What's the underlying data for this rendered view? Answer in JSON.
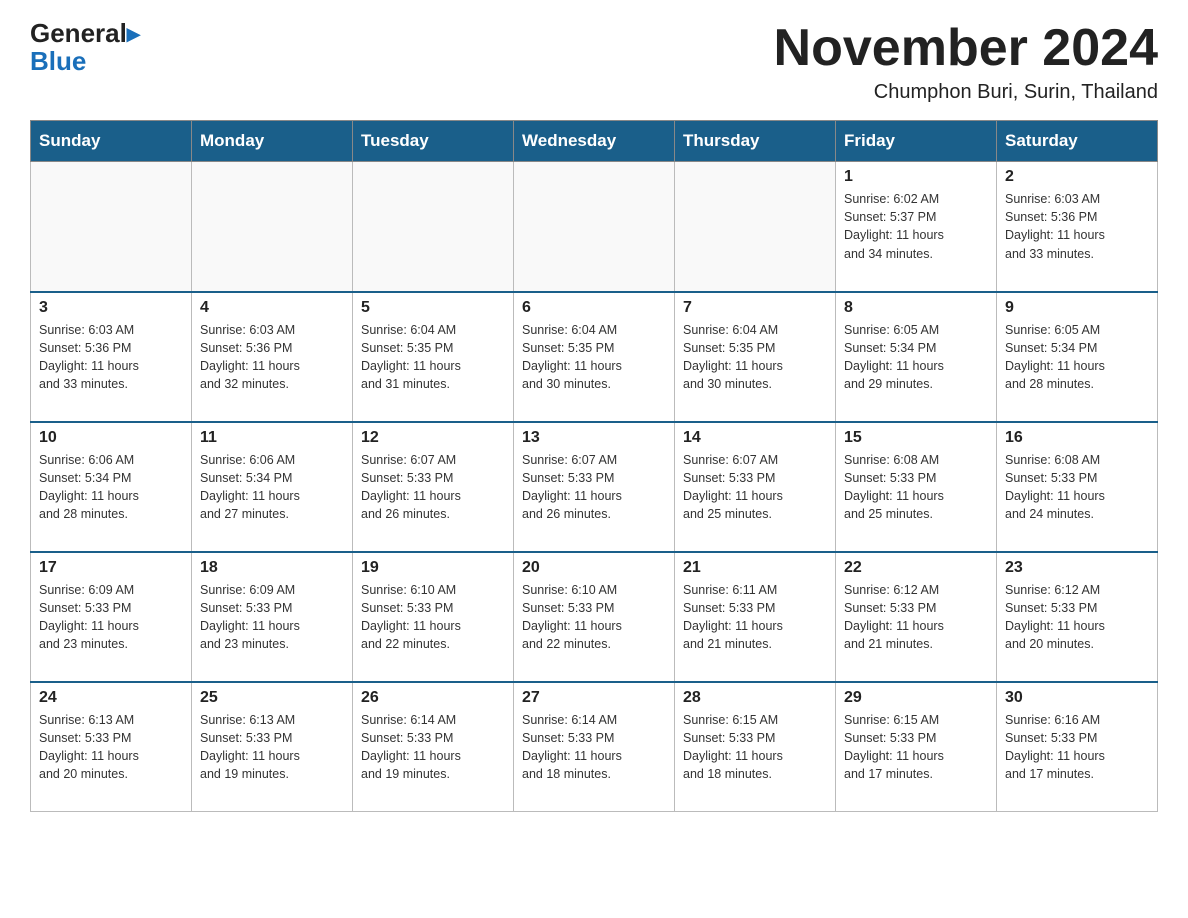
{
  "header": {
    "logo_general": "General",
    "logo_blue": "Blue",
    "title": "November 2024",
    "location": "Chumphon Buri, Surin, Thailand"
  },
  "days_of_week": [
    "Sunday",
    "Monday",
    "Tuesday",
    "Wednesday",
    "Thursday",
    "Friday",
    "Saturday"
  ],
  "weeks": [
    [
      {
        "day": "",
        "info": ""
      },
      {
        "day": "",
        "info": ""
      },
      {
        "day": "",
        "info": ""
      },
      {
        "day": "",
        "info": ""
      },
      {
        "day": "",
        "info": ""
      },
      {
        "day": "1",
        "info": "Sunrise: 6:02 AM\nSunset: 5:37 PM\nDaylight: 11 hours\nand 34 minutes."
      },
      {
        "day": "2",
        "info": "Sunrise: 6:03 AM\nSunset: 5:36 PM\nDaylight: 11 hours\nand 33 minutes."
      }
    ],
    [
      {
        "day": "3",
        "info": "Sunrise: 6:03 AM\nSunset: 5:36 PM\nDaylight: 11 hours\nand 33 minutes."
      },
      {
        "day": "4",
        "info": "Sunrise: 6:03 AM\nSunset: 5:36 PM\nDaylight: 11 hours\nand 32 minutes."
      },
      {
        "day": "5",
        "info": "Sunrise: 6:04 AM\nSunset: 5:35 PM\nDaylight: 11 hours\nand 31 minutes."
      },
      {
        "day": "6",
        "info": "Sunrise: 6:04 AM\nSunset: 5:35 PM\nDaylight: 11 hours\nand 30 minutes."
      },
      {
        "day": "7",
        "info": "Sunrise: 6:04 AM\nSunset: 5:35 PM\nDaylight: 11 hours\nand 30 minutes."
      },
      {
        "day": "8",
        "info": "Sunrise: 6:05 AM\nSunset: 5:34 PM\nDaylight: 11 hours\nand 29 minutes."
      },
      {
        "day": "9",
        "info": "Sunrise: 6:05 AM\nSunset: 5:34 PM\nDaylight: 11 hours\nand 28 minutes."
      }
    ],
    [
      {
        "day": "10",
        "info": "Sunrise: 6:06 AM\nSunset: 5:34 PM\nDaylight: 11 hours\nand 28 minutes."
      },
      {
        "day": "11",
        "info": "Sunrise: 6:06 AM\nSunset: 5:34 PM\nDaylight: 11 hours\nand 27 minutes."
      },
      {
        "day": "12",
        "info": "Sunrise: 6:07 AM\nSunset: 5:33 PM\nDaylight: 11 hours\nand 26 minutes."
      },
      {
        "day": "13",
        "info": "Sunrise: 6:07 AM\nSunset: 5:33 PM\nDaylight: 11 hours\nand 26 minutes."
      },
      {
        "day": "14",
        "info": "Sunrise: 6:07 AM\nSunset: 5:33 PM\nDaylight: 11 hours\nand 25 minutes."
      },
      {
        "day": "15",
        "info": "Sunrise: 6:08 AM\nSunset: 5:33 PM\nDaylight: 11 hours\nand 25 minutes."
      },
      {
        "day": "16",
        "info": "Sunrise: 6:08 AM\nSunset: 5:33 PM\nDaylight: 11 hours\nand 24 minutes."
      }
    ],
    [
      {
        "day": "17",
        "info": "Sunrise: 6:09 AM\nSunset: 5:33 PM\nDaylight: 11 hours\nand 23 minutes."
      },
      {
        "day": "18",
        "info": "Sunrise: 6:09 AM\nSunset: 5:33 PM\nDaylight: 11 hours\nand 23 minutes."
      },
      {
        "day": "19",
        "info": "Sunrise: 6:10 AM\nSunset: 5:33 PM\nDaylight: 11 hours\nand 22 minutes."
      },
      {
        "day": "20",
        "info": "Sunrise: 6:10 AM\nSunset: 5:33 PM\nDaylight: 11 hours\nand 22 minutes."
      },
      {
        "day": "21",
        "info": "Sunrise: 6:11 AM\nSunset: 5:33 PM\nDaylight: 11 hours\nand 21 minutes."
      },
      {
        "day": "22",
        "info": "Sunrise: 6:12 AM\nSunset: 5:33 PM\nDaylight: 11 hours\nand 21 minutes."
      },
      {
        "day": "23",
        "info": "Sunrise: 6:12 AM\nSunset: 5:33 PM\nDaylight: 11 hours\nand 20 minutes."
      }
    ],
    [
      {
        "day": "24",
        "info": "Sunrise: 6:13 AM\nSunset: 5:33 PM\nDaylight: 11 hours\nand 20 minutes."
      },
      {
        "day": "25",
        "info": "Sunrise: 6:13 AM\nSunset: 5:33 PM\nDaylight: 11 hours\nand 19 minutes."
      },
      {
        "day": "26",
        "info": "Sunrise: 6:14 AM\nSunset: 5:33 PM\nDaylight: 11 hours\nand 19 minutes."
      },
      {
        "day": "27",
        "info": "Sunrise: 6:14 AM\nSunset: 5:33 PM\nDaylight: 11 hours\nand 18 minutes."
      },
      {
        "day": "28",
        "info": "Sunrise: 6:15 AM\nSunset: 5:33 PM\nDaylight: 11 hours\nand 18 minutes."
      },
      {
        "day": "29",
        "info": "Sunrise: 6:15 AM\nSunset: 5:33 PM\nDaylight: 11 hours\nand 17 minutes."
      },
      {
        "day": "30",
        "info": "Sunrise: 6:16 AM\nSunset: 5:33 PM\nDaylight: 11 hours\nand 17 minutes."
      }
    ]
  ]
}
